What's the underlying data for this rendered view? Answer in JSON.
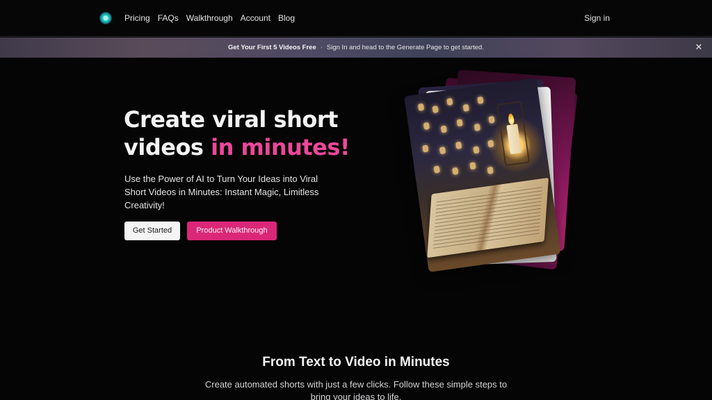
{
  "nav": {
    "links": [
      "Pricing",
      "FAQs",
      "Walkthrough",
      "Account",
      "Blog"
    ],
    "signin": "Sign in"
  },
  "banner": {
    "strong": "Get Your First 5 Videos Free",
    "separator": "·",
    "text": "Sign In and head to the Generate Page to get started.",
    "close": "✕"
  },
  "hero": {
    "title_line1": "Create viral short",
    "title_line2": "videos",
    "title_accent": "in minutes!",
    "subtitle": "Use the Power of AI to Turn Your Ideas into Viral Short Videos in Minutes: Instant Magic, Limitless Creativity!",
    "primary_button": "Get Started",
    "secondary_button": "Product Walkthrough"
  },
  "section": {
    "title": "From Text to Video in Minutes",
    "subtitle": "Create automated shorts with just a few clicks. Follow these simple steps to bring your ideas to life."
  },
  "colors": {
    "accent": "#ec4899",
    "button_accent": "#db2777",
    "background": "#050505"
  }
}
